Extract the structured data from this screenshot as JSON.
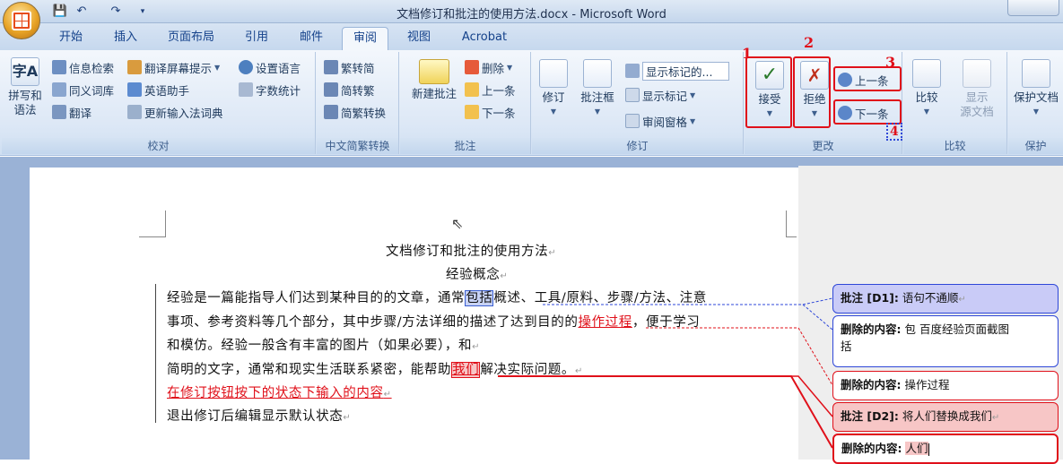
{
  "window": {
    "title": "文档修订和批注的使用方法.docx - Microsoft Word"
  },
  "tabs": [
    "开始",
    "插入",
    "页面布局",
    "引用",
    "邮件",
    "审阅",
    "视图",
    "Acrobat"
  ],
  "active_tab": "审阅",
  "ribbon": {
    "proofing": {
      "label": "校对",
      "spell_line1": "拼写和",
      "spell_line2": "语法",
      "research": "信息检索",
      "thesaurus": "同义词库",
      "translate": "翻译",
      "translate_tip": "翻译屏幕提示",
      "english_assistant": "英语助手",
      "update_ime": "更新输入法词典",
      "set_language": "设置语言",
      "word_count": "字数统计"
    },
    "chinese_conversion": {
      "label": "中文简繁转换",
      "to_simplified": "繁转简",
      "to_traditional": "简转繁",
      "conversion": "简繁转换"
    },
    "comments": {
      "label": "批注",
      "new_comment": "新建批注",
      "delete": "删除",
      "previous": "上一条",
      "next": "下一条"
    },
    "tracking": {
      "label": "修订",
      "track_changes": "修订",
      "balloons": "批注框",
      "display_select": "显示标记的...",
      "show_markup": "显示标记",
      "reviewing_pane": "审阅窗格"
    },
    "changes": {
      "label": "更改",
      "accept": "接受",
      "reject": "拒绝",
      "previous": "上一条",
      "next": "下一条"
    },
    "compare": {
      "label": "比较",
      "compare": "比较",
      "show_source_line1": "显示",
      "show_source_line2": "源文档"
    },
    "protect": {
      "label": "保护",
      "protect_doc": "保护文档"
    }
  },
  "annotations": [
    "1",
    "2",
    "3",
    "4"
  ],
  "document": {
    "title": "文档修订和批注的使用方法",
    "subtitle": "经验概念",
    "p1_a": "经验是一篇能指导人们达到某种目的的文章，通常",
    "p1_highlight": "包括",
    "p1_b": "概述、工具/原料、步骤/方法、注意",
    "p2_a": "事项、参考资料等几个部分，其中步骤/方法详细的描述了达到目的的",
    "p2_ins": "操作过程",
    "p2_b": "，便于学习",
    "p3": "和模仿。经验一般含有丰富的图片（如果必要），和",
    "p4_a": "简明的文字，通常和现实生活联系紧密，能帮助",
    "p4_ins": "我们",
    "p4_b": "解决实际问题。",
    "p5": "在修订按钮按下的状态下输入的内容",
    "p6": "退出修订后编辑显示默认状态"
  },
  "balloons": [
    {
      "label": "批注 [D1]:",
      "text": "语句不通顺"
    },
    {
      "label": "删除的内容:",
      "text": "包    百度经验页面截图",
      "text2": "括"
    },
    {
      "label": "删除的内容:",
      "text": "操作过程"
    },
    {
      "label": "批注 [D2]:",
      "text": "将人们替换成我们"
    },
    {
      "label": "删除的内容:",
      "text": "人们"
    }
  ]
}
